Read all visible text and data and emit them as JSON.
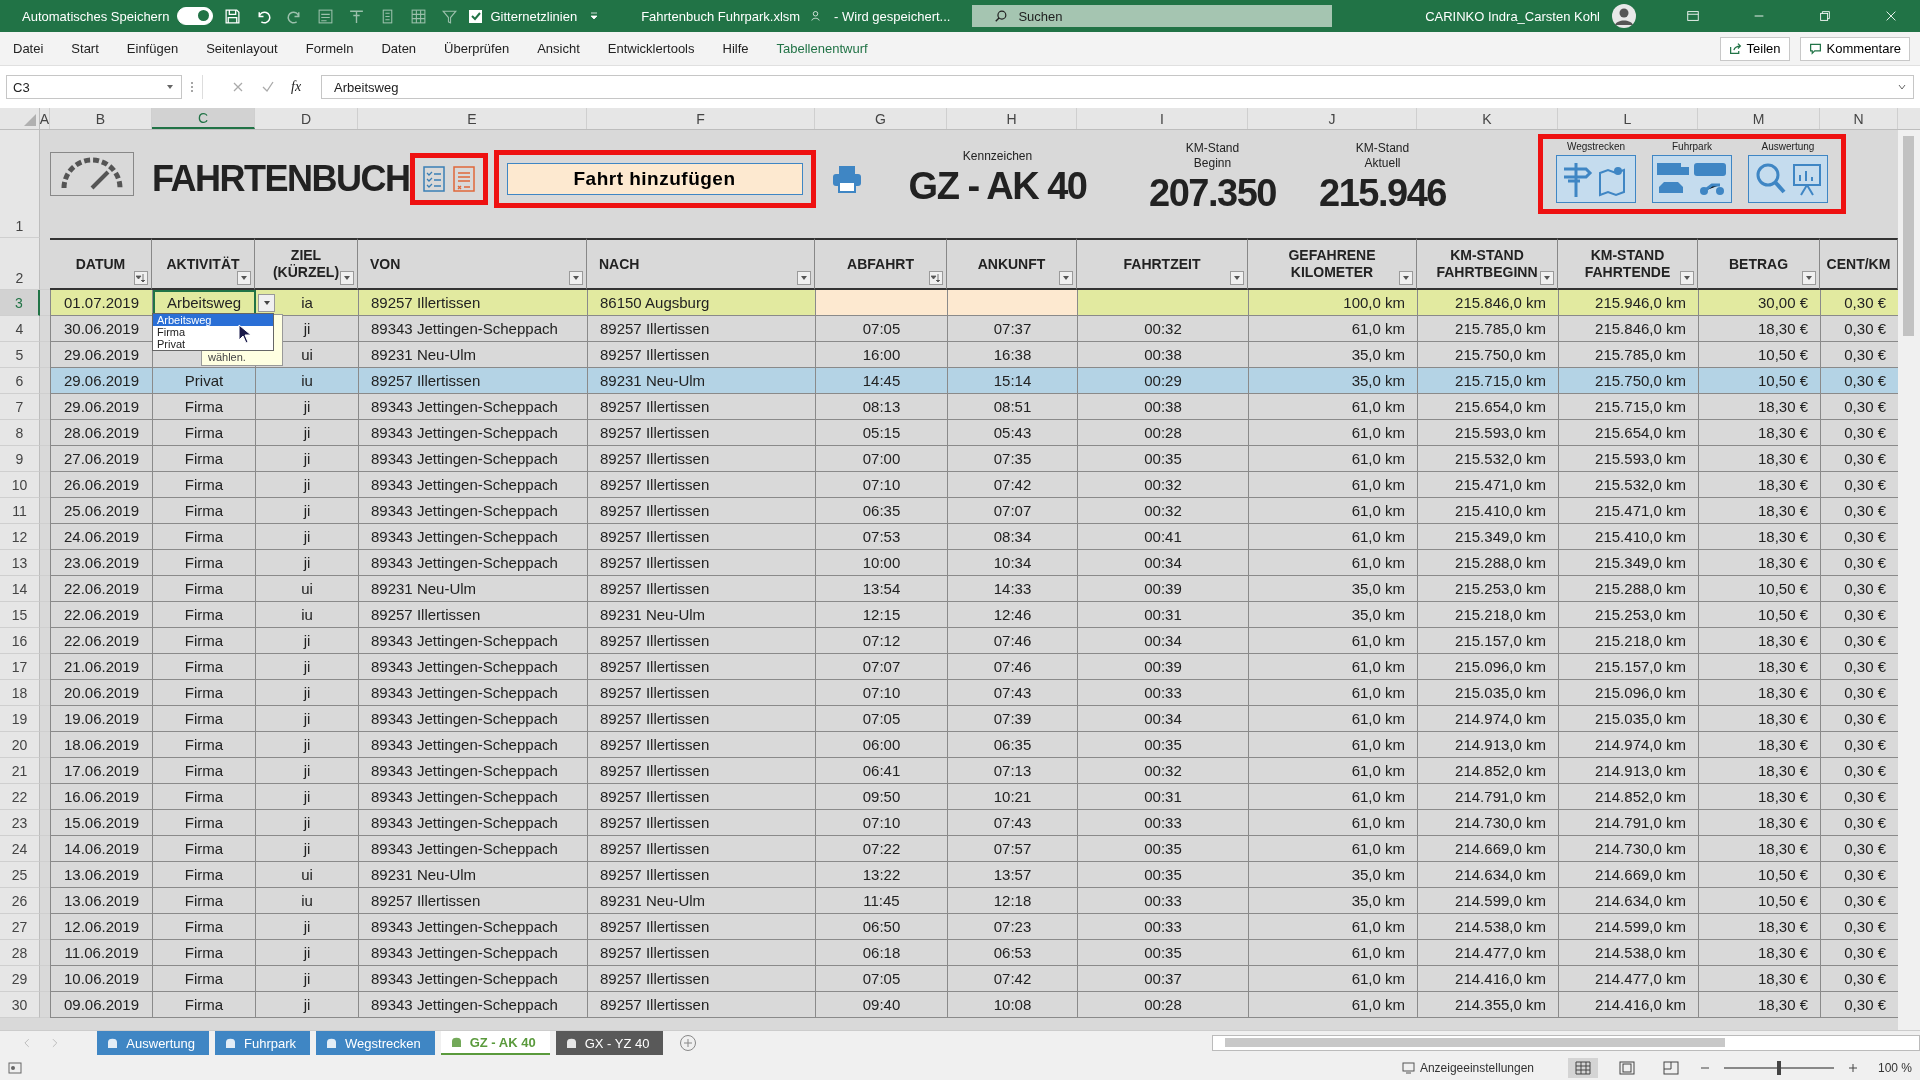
{
  "title_bar": {
    "autosave_label": "Automatisches Speichern",
    "autosave_on": true,
    "gridlines": {
      "label": "Gitternetzlinien",
      "checked": true
    },
    "file_name": "Fahrtenbuch Fuhrpark.xlsm",
    "save_status": "- Wird gespeichert...",
    "search_placeholder": "Suchen",
    "user": "CARINKO Indra_Carsten Kohl"
  },
  "ribbon_tabs": [
    {
      "label": "Datei",
      "kind": "normal"
    },
    {
      "label": "Start",
      "kind": "normal"
    },
    {
      "label": "Einfügen",
      "kind": "normal"
    },
    {
      "label": "Seitenlayout",
      "kind": "normal"
    },
    {
      "label": "Formeln",
      "kind": "normal"
    },
    {
      "label": "Daten",
      "kind": "normal"
    },
    {
      "label": "Überprüfen",
      "kind": "normal"
    },
    {
      "label": "Ansicht",
      "kind": "normal"
    },
    {
      "label": "Entwicklertools",
      "kind": "normal"
    },
    {
      "label": "Hilfe",
      "kind": "normal"
    },
    {
      "label": "Tabellenentwurf",
      "kind": "contextual"
    }
  ],
  "ribbon_buttons": [
    "Teilen",
    "Kommentare"
  ],
  "formula_bar": {
    "name_box": "C3",
    "function_symbol": "fx",
    "value": "Arbeitsweg"
  },
  "column_letters": [
    {
      "label": "A",
      "selected": false
    },
    {
      "label": "B",
      "selected": false
    },
    {
      "label": "C",
      "selected": true
    },
    {
      "label": "D",
      "selected": false
    },
    {
      "label": "E",
      "selected": false
    },
    {
      "label": "F",
      "selected": false
    },
    {
      "label": "G",
      "selected": false
    },
    {
      "label": "H",
      "selected": false
    },
    {
      "label": "I",
      "selected": false
    },
    {
      "label": "J",
      "selected": false
    },
    {
      "label": "K",
      "selected": false
    },
    {
      "label": "L",
      "selected": false
    },
    {
      "label": "M",
      "selected": false
    },
    {
      "label": "N",
      "selected": false
    }
  ],
  "dashboard": {
    "row_number": "1",
    "title": "FAHRTENBUCH",
    "add_button": "Fahrt hinzufügen",
    "stats": [
      {
        "label": "Kennzeichen",
        "value": "GZ - AK 40"
      },
      {
        "label": "KM-Stand Beginn",
        "value": "207.350"
      },
      {
        "label": "KM-Stand Aktuell",
        "value": "215.946"
      }
    ],
    "nav_groups": [
      {
        "label": "Wegstrecken",
        "kind": "routes"
      },
      {
        "label": "Fuhrpark",
        "kind": "fleet"
      },
      {
        "label": "Auswertung",
        "kind": "analysis"
      }
    ]
  },
  "table": {
    "header_row_number": "2",
    "columns": [
      {
        "label": "DATUM",
        "kind": "sorted"
      },
      {
        "label": "AKTIVITÄT",
        "kind": "filter"
      },
      {
        "label": "ZIEL (KÜRZEL)",
        "kind": "filter"
      },
      {
        "label": "VON",
        "kind": "filter"
      },
      {
        "label": "NACH",
        "kind": "filter"
      },
      {
        "label": "ABFAHRT",
        "kind": "sorted"
      },
      {
        "label": "ANKUNFT",
        "kind": "filter"
      },
      {
        "label": "FAHRTZEIT",
        "kind": "filter"
      },
      {
        "label": "GEFAHRENE KILOMETER",
        "kind": "filter"
      },
      {
        "label": "KM-STAND FAHRTBEGINN",
        "kind": "filter"
      },
      {
        "label": "KM-STAND FAHRTENDE",
        "kind": "filter"
      },
      {
        "label": "BETRAG",
        "kind": "filter"
      },
      {
        "label": "CENT/KM",
        "kind": "plain"
      }
    ],
    "rows": [
      {
        "number": "3",
        "kind": "new",
        "selected": false,
        "cells": [
          "01.07.2019",
          "Arbeitsweg",
          "ia",
          "89257 Illertissen",
          "86150 Augsburg",
          null,
          null,
          null,
          "100,0 km",
          "215.846,0 km",
          "215.946,0 km",
          "30,00 €",
          "0,30 €"
        ]
      },
      {
        "number": "4",
        "kind": "entry",
        "selected": false,
        "cells": [
          "30.06.2019",
          null,
          "ji",
          "89343 Jettingen-Scheppach",
          "89257 Illertissen",
          "07:05",
          "07:37",
          "00:32",
          "61,0 km",
          "215.785,0 km",
          "215.846,0 km",
          "18,30 €",
          "0,30 €"
        ]
      },
      {
        "number": "5",
        "kind": "entry",
        "selected": false,
        "cells": [
          "29.06.2019",
          null,
          "ui",
          "89231 Neu-Ulm",
          "89257 Illertissen",
          "16:00",
          "16:38",
          "00:38",
          "35,0 km",
          "215.750,0 km",
          "215.785,0 km",
          "10,50 €",
          "0,30 €"
        ]
      },
      {
        "number": "6",
        "kind": "entry",
        "selected": true,
        "cells": [
          "29.06.2019",
          "Privat",
          "iu",
          "89257 Illertissen",
          "89231 Neu-Ulm",
          "14:45",
          "15:14",
          "00:29",
          "35,0 km",
          "215.715,0 km",
          "215.750,0 km",
          "10,50 €",
          "0,30 €"
        ]
      },
      {
        "number": "7",
        "kind": "entry",
        "selected": false,
        "cells": [
          "29.06.2019",
          "Firma",
          "ji",
          "89343 Jettingen-Scheppach",
          "89257 Illertissen",
          "08:13",
          "08:51",
          "00:38",
          "61,0 km",
          "215.654,0 km",
          "215.715,0 km",
          "18,30 €",
          "0,30 €"
        ]
      },
      {
        "number": "8",
        "kind": "entry",
        "selected": false,
        "cells": [
          "28.06.2019",
          "Firma",
          "ji",
          "89343 Jettingen-Scheppach",
          "89257 Illertissen",
          "05:15",
          "05:43",
          "00:28",
          "61,0 km",
          "215.593,0 km",
          "215.654,0 km",
          "18,30 €",
          "0,30 €"
        ]
      },
      {
        "number": "9",
        "kind": "entry",
        "selected": false,
        "cells": [
          "27.06.2019",
          "Firma",
          "ji",
          "89343 Jettingen-Scheppach",
          "89257 Illertissen",
          "07:00",
          "07:35",
          "00:35",
          "61,0 km",
          "215.532,0 km",
          "215.593,0 km",
          "18,30 €",
          "0,30 €"
        ]
      },
      {
        "number": "10",
        "kind": "entry",
        "selected": false,
        "cells": [
          "26.06.2019",
          "Firma",
          "ji",
          "89343 Jettingen-Scheppach",
          "89257 Illertissen",
          "07:10",
          "07:42",
          "00:32",
          "61,0 km",
          "215.471,0 km",
          "215.532,0 km",
          "18,30 €",
          "0,30 €"
        ]
      },
      {
        "number": "11",
        "kind": "entry",
        "selected": false,
        "cells": [
          "25.06.2019",
          "Firma",
          "ji",
          "89343 Jettingen-Scheppach",
          "89257 Illertissen",
          "06:35",
          "07:07",
          "00:32",
          "61,0 km",
          "215.410,0 km",
          "215.471,0 km",
          "18,30 €",
          "0,30 €"
        ]
      },
      {
        "number": "12",
        "kind": "entry",
        "selected": false,
        "cells": [
          "24.06.2019",
          "Firma",
          "ji",
          "89343 Jettingen-Scheppach",
          "89257 Illertissen",
          "07:53",
          "08:34",
          "00:41",
          "61,0 km",
          "215.349,0 km",
          "215.410,0 km",
          "18,30 €",
          "0,30 €"
        ]
      },
      {
        "number": "13",
        "kind": "entry",
        "selected": false,
        "cells": [
          "23.06.2019",
          "Firma",
          "ji",
          "89343 Jettingen-Scheppach",
          "89257 Illertissen",
          "10:00",
          "10:34",
          "00:34",
          "61,0 km",
          "215.288,0 km",
          "215.349,0 km",
          "18,30 €",
          "0,30 €"
        ]
      },
      {
        "number": "14",
        "kind": "entry",
        "selected": false,
        "cells": [
          "22.06.2019",
          "Firma",
          "ui",
          "89231 Neu-Ulm",
          "89257 Illertissen",
          "13:54",
          "14:33",
          "00:39",
          "35,0 km",
          "215.253,0 km",
          "215.288,0 km",
          "10,50 €",
          "0,30 €"
        ]
      },
      {
        "number": "15",
        "kind": "entry",
        "selected": false,
        "cells": [
          "22.06.2019",
          "Firma",
          "iu",
          "89257 Illertissen",
          "89231 Neu-Ulm",
          "12:15",
          "12:46",
          "00:31",
          "35,0 km",
          "215.218,0 km",
          "215.253,0 km",
          "10,50 €",
          "0,30 €"
        ]
      },
      {
        "number": "16",
        "kind": "entry",
        "selected": false,
        "cells": [
          "22.06.2019",
          "Firma",
          "ji",
          "89343 Jettingen-Scheppach",
          "89257 Illertissen",
          "07:12",
          "07:46",
          "00:34",
          "61,0 km",
          "215.157,0 km",
          "215.218,0 km",
          "18,30 €",
          "0,30 €"
        ]
      },
      {
        "number": "17",
        "kind": "entry",
        "selected": false,
        "cells": [
          "21.06.2019",
          "Firma",
          "ji",
          "89343 Jettingen-Scheppach",
          "89257 Illertissen",
          "07:07",
          "07:46",
          "00:39",
          "61,0 km",
          "215.096,0 km",
          "215.157,0 km",
          "18,30 €",
          "0,30 €"
        ]
      },
      {
        "number": "18",
        "kind": "entry",
        "selected": false,
        "cells": [
          "20.06.2019",
          "Firma",
          "ji",
          "89343 Jettingen-Scheppach",
          "89257 Illertissen",
          "07:10",
          "07:43",
          "00:33",
          "61,0 km",
          "215.035,0 km",
          "215.096,0 km",
          "18,30 €",
          "0,30 €"
        ]
      },
      {
        "number": "19",
        "kind": "entry",
        "selected": false,
        "cells": [
          "19.06.2019",
          "Firma",
          "ji",
          "89343 Jettingen-Scheppach",
          "89257 Illertissen",
          "07:05",
          "07:39",
          "00:34",
          "61,0 km",
          "214.974,0 km",
          "215.035,0 km",
          "18,30 €",
          "0,30 €"
        ]
      },
      {
        "number": "20",
        "kind": "entry",
        "selected": false,
        "cells": [
          "18.06.2019",
          "Firma",
          "ji",
          "89343 Jettingen-Scheppach",
          "89257 Illertissen",
          "06:00",
          "06:35",
          "00:35",
          "61,0 km",
          "214.913,0 km",
          "214.974,0 km",
          "18,30 €",
          "0,30 €"
        ]
      },
      {
        "number": "21",
        "kind": "entry",
        "selected": false,
        "cells": [
          "17.06.2019",
          "Firma",
          "ji",
          "89343 Jettingen-Scheppach",
          "89257 Illertissen",
          "06:41",
          "07:13",
          "00:32",
          "61,0 km",
          "214.852,0 km",
          "214.913,0 km",
          "18,30 €",
          "0,30 €"
        ]
      },
      {
        "number": "22",
        "kind": "entry",
        "selected": false,
        "cells": [
          "16.06.2019",
          "Firma",
          "ji",
          "89343 Jettingen-Scheppach",
          "89257 Illertissen",
          "09:50",
          "10:21",
          "00:31",
          "61,0 km",
          "214.791,0 km",
          "214.852,0 km",
          "18,30 €",
          "0,30 €"
        ]
      },
      {
        "number": "23",
        "kind": "entry",
        "selected": false,
        "cells": [
          "15.06.2019",
          "Firma",
          "ji",
          "89343 Jettingen-Scheppach",
          "89257 Illertissen",
          "07:10",
          "07:43",
          "00:33",
          "61,0 km",
          "214.730,0 km",
          "214.791,0 km",
          "18,30 €",
          "0,30 €"
        ]
      },
      {
        "number": "24",
        "kind": "entry",
        "selected": false,
        "cells": [
          "14.06.2019",
          "Firma",
          "ji",
          "89343 Jettingen-Scheppach",
          "89257 Illertissen",
          "07:22",
          "07:57",
          "00:35",
          "61,0 km",
          "214.669,0 km",
          "214.730,0 km",
          "18,30 €",
          "0,30 €"
        ]
      },
      {
        "number": "25",
        "kind": "entry",
        "selected": false,
        "cells": [
          "13.06.2019",
          "Firma",
          "ui",
          "89231 Neu-Ulm",
          "89257 Illertissen",
          "13:22",
          "13:57",
          "00:35",
          "35,0 km",
          "214.634,0 km",
          "214.669,0 km",
          "10,50 €",
          "0,30 €"
        ]
      },
      {
        "number": "26",
        "kind": "entry",
        "selected": false,
        "cells": [
          "13.06.2019",
          "Firma",
          "iu",
          "89257 Illertissen",
          "89231 Neu-Ulm",
          "11:45",
          "12:18",
          "00:33",
          "35,0 km",
          "214.599,0 km",
          "214.634,0 km",
          "10,50 €",
          "0,30 €"
        ]
      },
      {
        "number": "27",
        "kind": "entry",
        "selected": false,
        "cells": [
          "12.06.2019",
          "Firma",
          "ji",
          "89343 Jettingen-Scheppach",
          "89257 Illertissen",
          "06:50",
          "07:23",
          "00:33",
          "61,0 km",
          "214.538,0 km",
          "214.599,0 km",
          "18,30 €",
          "0,30 €"
        ]
      },
      {
        "number": "28",
        "kind": "entry",
        "selected": false,
        "cells": [
          "11.06.2019",
          "Firma",
          "ji",
          "89343 Jettingen-Scheppach",
          "89257 Illertissen",
          "06:18",
          "06:53",
          "00:35",
          "61,0 km",
          "214.477,0 km",
          "214.538,0 km",
          "18,30 €",
          "0,30 €"
        ]
      },
      {
        "number": "29",
        "kind": "entry",
        "selected": false,
        "cells": [
          "10.06.2019",
          "Firma",
          "ji",
          "89343 Jettingen-Scheppach",
          "89257 Illertissen",
          "07:05",
          "07:42",
          "00:37",
          "61,0 km",
          "214.416,0 km",
          "214.477,0 km",
          "18,30 €",
          "0,30 €"
        ]
      },
      {
        "number": "30",
        "kind": "entry",
        "selected": false,
        "cells": [
          "09.06.2019",
          "Firma",
          "ji",
          "89343 Jettingen-Scheppach",
          "89257 Illertissen",
          "09:40",
          "10:08",
          "00:28",
          "61,0 km",
          "214.355,0 km",
          "214.416,0 km",
          "18,30 €",
          "0,30 €"
        ]
      }
    ]
  },
  "dropdown": {
    "options": [
      {
        "label": "Arbeitsweg",
        "selected": true
      },
      {
        "label": "Firma",
        "selected": false
      },
      {
        "label": "Privat",
        "selected": false
      }
    ],
    "tooltip": "wählen."
  },
  "sheet_tabs": [
    {
      "label": "Auswertung",
      "color": "#3f86c4",
      "selected": false
    },
    {
      "label": "Fuhrpark",
      "color": "#3f86c4",
      "selected": false
    },
    {
      "label": "Wegstrecken",
      "color": "#3f86c4",
      "selected": false
    },
    {
      "label": "GZ - AK 40",
      "color": "#5a9a3c",
      "selected": true
    },
    {
      "label": "GX - YZ 40",
      "color": "#595959",
      "selected": false
    }
  ],
  "status_bar": {
    "display_settings": "Anzeigeeinstellungen",
    "zoom": {
      "level": 0.5,
      "reading": "100 %"
    }
  }
}
